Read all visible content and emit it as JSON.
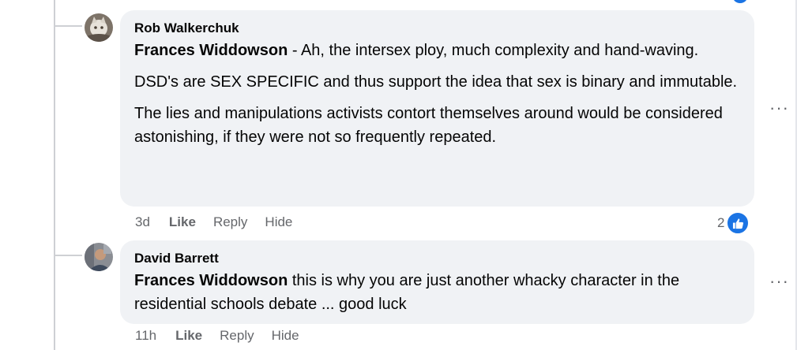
{
  "comments": [
    {
      "author": "Rob Walkerchuk",
      "paragraphs": [
        {
          "mention": "Frances Widdowson",
          "text": " - Ah, the intersex ploy, much complexity and hand-waving."
        },
        {
          "mention": "",
          "text": "DSD's are SEX SPECIFIC and thus support the idea that sex is binary and immutable."
        },
        {
          "mention": "",
          "text": "The lies and manipulations activists contort themselves around would be considered astonishing, if they were not so frequently repeated."
        }
      ],
      "time": "3d",
      "like_label": "Like",
      "reply_label": "Reply",
      "hide_label": "Hide",
      "reaction_count": "2",
      "more_label": "···"
    },
    {
      "author": "David Barrett",
      "paragraphs": [
        {
          "mention": "Frances Widdowson",
          "text": " this is why you are just another whacky character in the residential schools debate ... good luck"
        }
      ],
      "time": "11h",
      "like_label": "Like",
      "reply_label": "Reply",
      "hide_label": "Hide",
      "more_label": "···"
    }
  ],
  "colors": {
    "bubble_bg": "#f0f2f5",
    "meta_text": "#65676b",
    "like_blue": "#1b74e4",
    "thread_line": "#ced0d4"
  }
}
